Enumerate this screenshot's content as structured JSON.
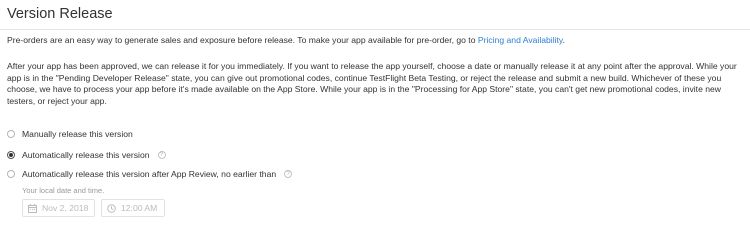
{
  "section": {
    "title": "Version Release"
  },
  "intro": {
    "text": "Pre-orders are an easy way to generate sales and exposure before release. To make your app available for pre-order, go to ",
    "link_label": "Pricing and Availability",
    "suffix": "."
  },
  "description": {
    "text": "After your app has been approved, we can release it for you immediately. If you want to release the app yourself, choose a date or manually release it at any point after the approval. While your app is in the \"Pending Developer Release\" state, you can give out promotional codes, continue TestFlight Beta Testing, or reject the release and submit a new build. Whichever of these you choose, we have to process your app before it's made available on the App Store. While your app is in the \"Processing for App Store\" state, you can't get new promotional codes, invite new testers, or reject your app."
  },
  "release_options": [
    {
      "label": "Manually release this version",
      "selected": false,
      "has_help": false
    },
    {
      "label": "Automatically release this version",
      "selected": true,
      "has_help": true
    },
    {
      "label": "Automatically release this version after App Review, no earlier than",
      "selected": false,
      "has_help": true
    }
  ],
  "scheduled": {
    "hint": "Your local date and time.",
    "date_value": "Nov 2, 2018",
    "date_icon": "calendar-icon",
    "time_value": "12:00 AM",
    "time_icon": "clock-icon"
  },
  "help_glyph": "?",
  "colors": {
    "link": "#2d7fd3",
    "text": "#333333",
    "muted": "#999999",
    "border": "#e2e2e2"
  }
}
